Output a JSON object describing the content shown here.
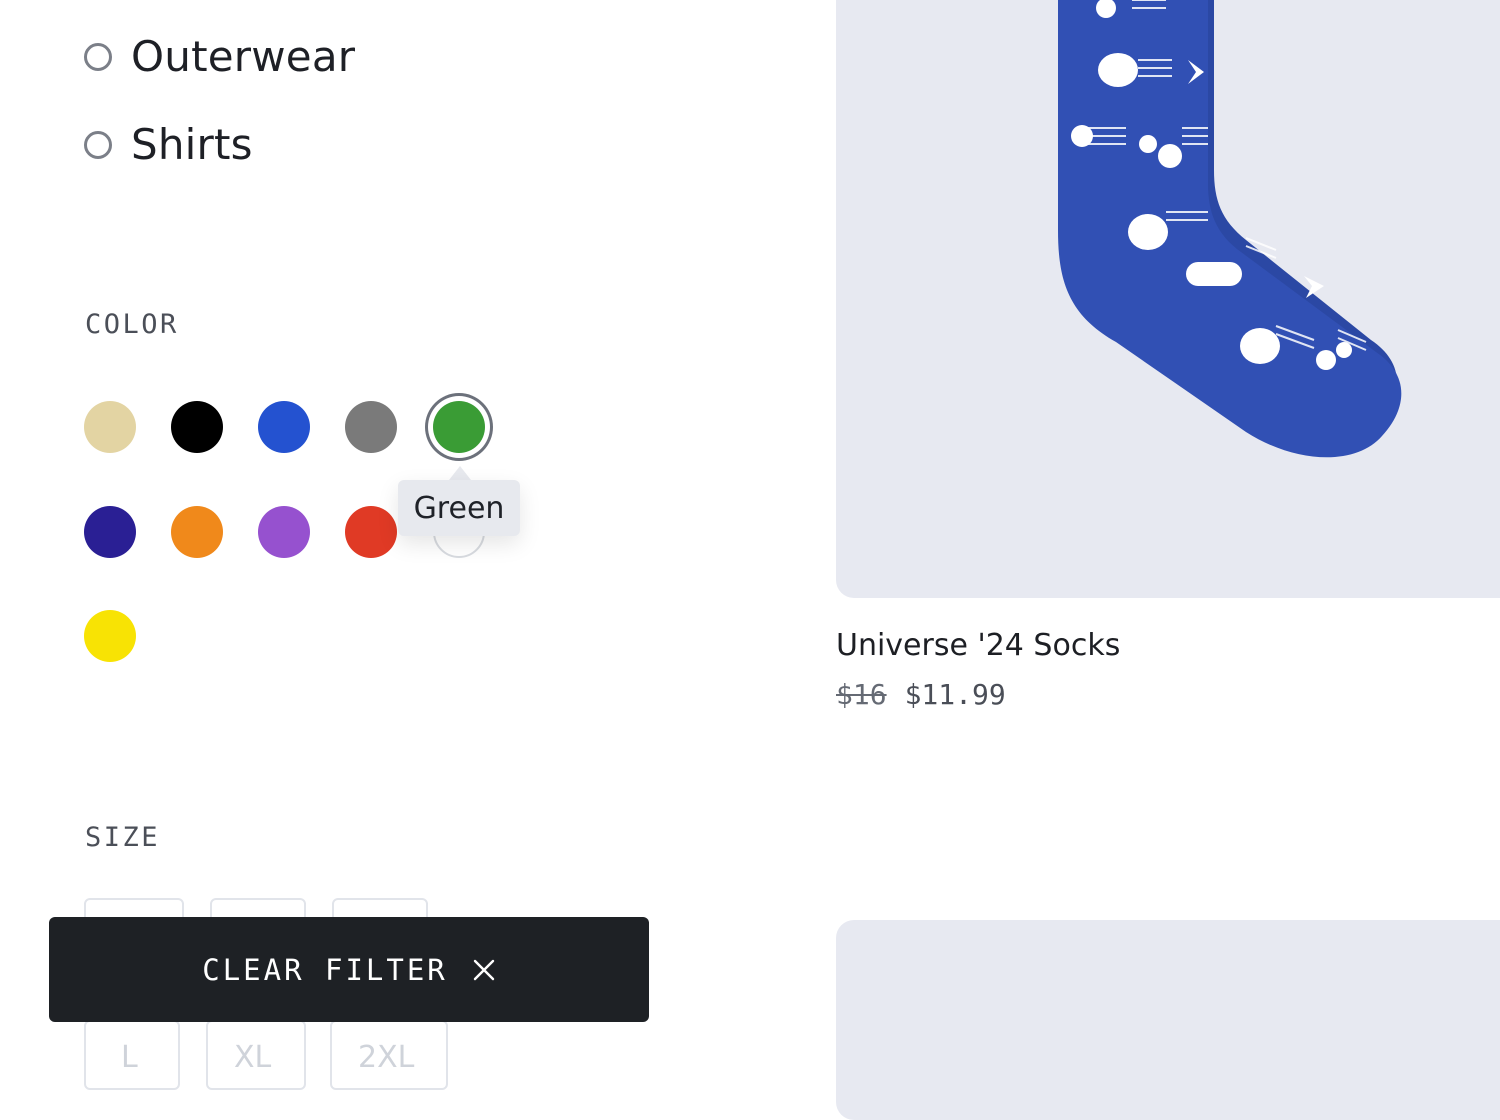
{
  "filters": {
    "categories": [
      {
        "label": "Outerwear"
      },
      {
        "label": "Shirts"
      }
    ],
    "color": {
      "heading": "COLOR",
      "swatches": [
        {
          "name": "beige",
          "hex": "#e3d4a3"
        },
        {
          "name": "black",
          "hex": "#000000"
        },
        {
          "name": "blue",
          "hex": "#2452d0"
        },
        {
          "name": "gray",
          "hex": "#7a7a7a"
        },
        {
          "name": "green",
          "hex": "#3a9c35",
          "selected": true
        },
        {
          "name": "indigo",
          "hex": "#2a1f94"
        },
        {
          "name": "orange",
          "hex": "#f0891b"
        },
        {
          "name": "purple",
          "hex": "#9651cf"
        },
        {
          "name": "red",
          "hex": "#e03a25"
        },
        {
          "name": "white",
          "hex": "#ffffff"
        },
        {
          "name": "yellow",
          "hex": "#f8e304"
        }
      ],
      "tooltip": "Green"
    },
    "size": {
      "heading": "SIZE",
      "options": [
        "L",
        "XL",
        "2XL"
      ]
    },
    "clear_filter_label": "CLEAR FILTER"
  },
  "products": [
    {
      "name": "Universe '24 Socks",
      "price_original": "$16",
      "price_sale": "$11.99",
      "image_bg": "#e7e9f1",
      "sock_color": "#2d4fb0"
    }
  ]
}
